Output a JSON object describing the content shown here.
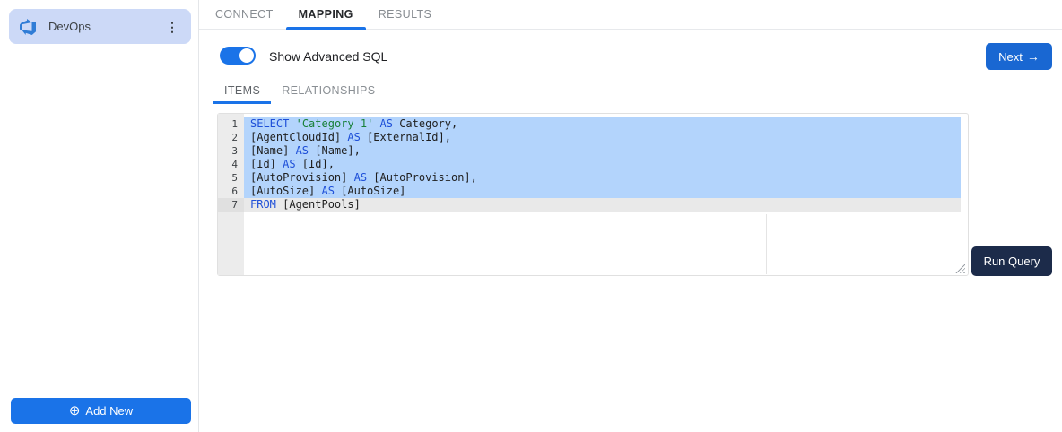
{
  "colors": {
    "accent": "#1a73e8",
    "next_button": "#1967d2",
    "run_query_button": "#1c2b4a",
    "connector_card": "#ccd9f7",
    "selection": "#b3d4fc",
    "active_line": "#e9e9e9",
    "keyword": "#1e4fd8",
    "string": "#188038",
    "code_text": "#1f1f1f"
  },
  "icons": {
    "arrow_right": "→",
    "kebab": "⋮",
    "add_circle": "⊕"
  },
  "sidebar": {
    "connector": {
      "label": "DevOps",
      "icon": "azure-devops-icon"
    },
    "add_new_label": "Add New"
  },
  "tabs": [
    {
      "label": "CONNECT",
      "active": false
    },
    {
      "label": "MAPPING",
      "active": true
    },
    {
      "label": "RESULTS",
      "active": false
    }
  ],
  "toolbar": {
    "toggle_label": "Show Advanced SQL",
    "toggle_on": true,
    "next_label": "Next"
  },
  "sub_tabs": [
    {
      "label": "ITEMS",
      "active": true
    },
    {
      "label": "RELATIONSHIPS",
      "active": false
    }
  ],
  "editor": {
    "run_query_label": "Run Query",
    "selected_lines": [
      1,
      2,
      3,
      4,
      5,
      6
    ],
    "active_line": 7,
    "lines": [
      [
        {
          "t": "kw",
          "v": "SELECT"
        },
        {
          "t": "pl",
          "v": " "
        },
        {
          "t": "str",
          "v": "'Category 1'"
        },
        {
          "t": "pl",
          "v": " "
        },
        {
          "t": "kw",
          "v": "AS"
        },
        {
          "t": "pl",
          "v": " Category,"
        }
      ],
      [
        {
          "t": "pl",
          "v": "[AgentCloudId] "
        },
        {
          "t": "kw",
          "v": "AS"
        },
        {
          "t": "pl",
          "v": " [ExternalId],"
        }
      ],
      [
        {
          "t": "pl",
          "v": "[Name] "
        },
        {
          "t": "kw",
          "v": "AS"
        },
        {
          "t": "pl",
          "v": " [Name],"
        }
      ],
      [
        {
          "t": "pl",
          "v": "[Id] "
        },
        {
          "t": "kw",
          "v": "AS"
        },
        {
          "t": "pl",
          "v": " [Id],"
        }
      ],
      [
        {
          "t": "pl",
          "v": "[AutoProvision] "
        },
        {
          "t": "kw",
          "v": "AS"
        },
        {
          "t": "pl",
          "v": " [AutoProvision],"
        }
      ],
      [
        {
          "t": "pl",
          "v": "[AutoSize] "
        },
        {
          "t": "kw",
          "v": "AS"
        },
        {
          "t": "pl",
          "v": " [AutoSize]"
        }
      ],
      [
        {
          "t": "kw",
          "v": "FROM"
        },
        {
          "t": "pl",
          "v": " [AgentPools]"
        }
      ]
    ]
  }
}
